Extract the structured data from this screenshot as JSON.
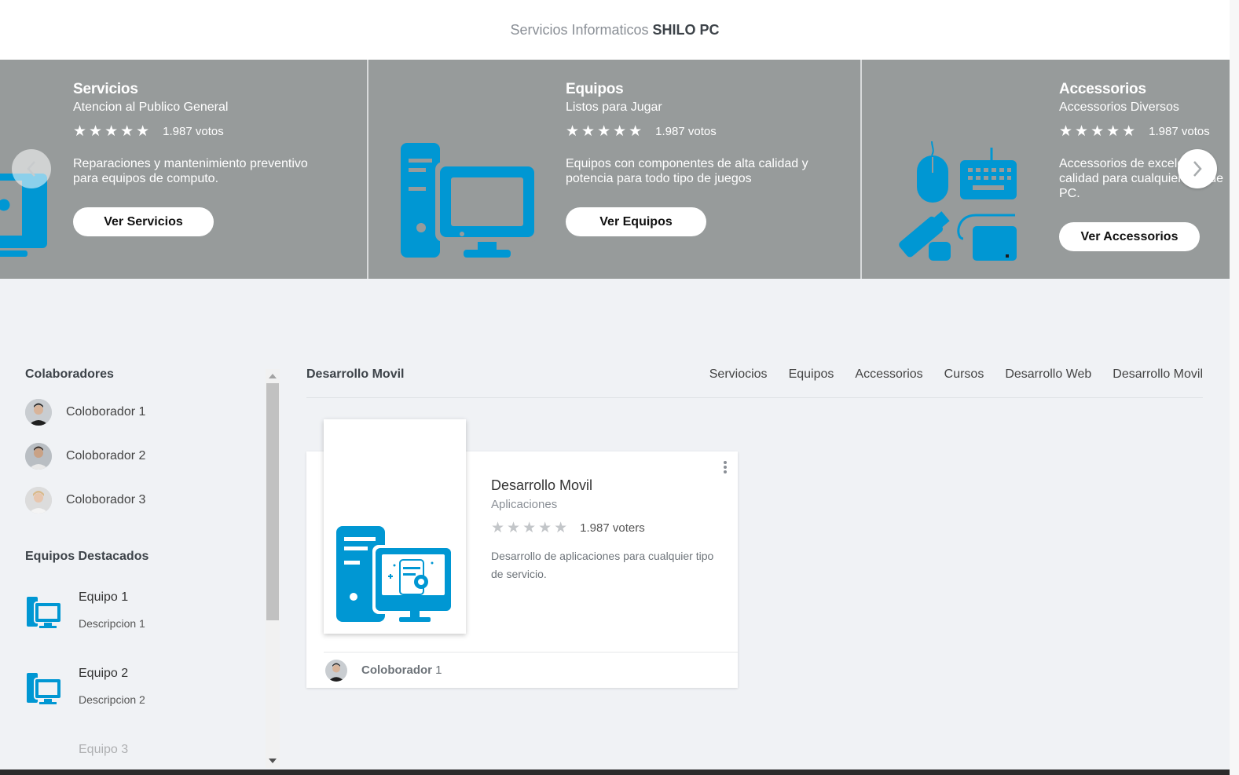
{
  "header": {
    "brand_prefix": "Servicios Informaticos",
    "brand_name": "SHILO PC"
  },
  "carousel": {
    "slides": [
      {
        "title": "Servicios",
        "subtitle": "Atencion al Publico General",
        "stars": "★★★★★",
        "votes": "1.987 votos",
        "description": "Reparaciones y mantenimiento preventivo para equipos de computo.",
        "button": "Ver Servicios"
      },
      {
        "title": "Equipos",
        "subtitle": "Listos para Jugar",
        "stars": "★★★★★",
        "votes": "1.987 votos",
        "description": "Equipos con componentes de alta calidad y potencia para todo tipo de juegos",
        "button": "Ver Equipos"
      },
      {
        "title": "Accessorios",
        "subtitle": "Accessorios Diversos",
        "stars": "★★★★★",
        "votes": "1.987 votos",
        "description": "Accessorios de excelente calidad para cualquier tipo de PC.",
        "button": "Ver Accessorios"
      }
    ]
  },
  "sidebar": {
    "collaborators_heading": "Colaboradores",
    "collaborators": [
      {
        "name": "Coloborador 1"
      },
      {
        "name": "Coloborador 2"
      },
      {
        "name": "Coloborador 3"
      }
    ],
    "featured_heading": "Equipos Destacados",
    "featured": [
      {
        "name": "Equipo 1",
        "desc": "Descripcion 1"
      },
      {
        "name": "Equipo 2",
        "desc": "Descripcion 2"
      },
      {
        "name": "Equipo 3",
        "desc": ""
      }
    ]
  },
  "main": {
    "section_title": "Desarrollo Movil",
    "tabs": [
      "Serviocios",
      "Equipos",
      "Accessorios",
      "Cursos",
      "Desarrollo Web",
      "Desarrollo Movil"
    ],
    "card": {
      "title": "Desarrollo Movil",
      "subtitle": "Aplicaciones",
      "stars": "★★★★★",
      "voters": "1.987 voters",
      "description": "Desarrollo de aplicaciones para cualquier tipo de servicio.",
      "author_name": "Coloborador",
      "author_num": "1"
    }
  },
  "colors": {
    "accent": "#0097d3",
    "hero_bg": "#979b9b",
    "page_bg": "#f0f2f5"
  },
  "icons": [
    "computer-icon",
    "peripherals-icon",
    "chevron-left-icon",
    "chevron-right-icon",
    "star-icon",
    "more-vert-icon",
    "avatar"
  ]
}
